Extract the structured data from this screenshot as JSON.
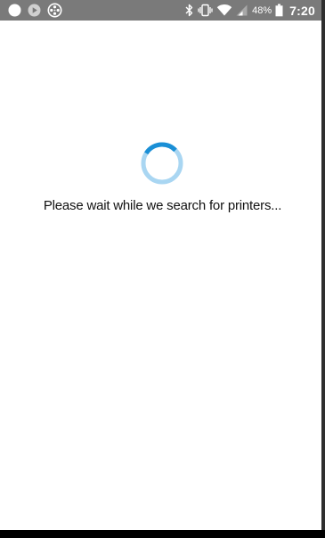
{
  "status_bar": {
    "battery_percent": "48%",
    "time": "7:20",
    "background_color": "#7a7a7a",
    "left_icons": [
      "notification-dot-icon",
      "play-store-icon",
      "film-reel-icon"
    ],
    "right_icons": [
      "bluetooth-icon",
      "vibrate-icon",
      "wifi-icon",
      "cell-signal-icon",
      "battery-icon"
    ]
  },
  "main": {
    "loading_message": "Please wait while we search for printers...",
    "spinner_color": "#1a8fd6",
    "spinner_track_color": "#a9d6f2"
  }
}
